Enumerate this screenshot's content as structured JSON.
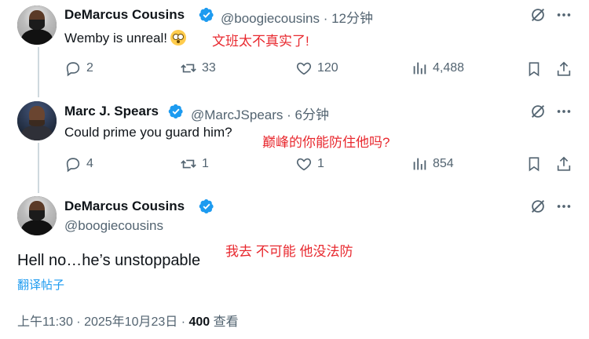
{
  "tweets": [
    {
      "author": "DeMarcus Cousins",
      "handle": "@boogiecousins",
      "time": "12分钟",
      "text": "Wemby is unreal!",
      "annotation": "文班太不真实了!",
      "replies": "2",
      "reposts": "33",
      "likes": "120",
      "views": "4,488"
    },
    {
      "author": "Marc J. Spears",
      "handle": "@MarcJSpears",
      "time": "6分钟",
      "text": "Could prime you guard him?",
      "annotation": "巅峰的你能防住他吗?",
      "replies": "4",
      "reposts": "1",
      "likes": "1",
      "views": "854"
    }
  ],
  "main_tweet": {
    "author": "DeMarcus Cousins",
    "handle": "@boogiecousins",
    "text": "Hell no…he’s unstoppable",
    "annotation": "我去 不可能 他没法防",
    "translate_label": "翻译帖子",
    "timestamp": "上午11:30 · 2025年10月23日 · ",
    "views": "400",
    "views_label": " 查看"
  },
  "colors": {
    "accent": "#1d9bf0",
    "annotation": "#e8292f",
    "muted": "#536471"
  },
  "icons": [
    "verified-badge-icon",
    "grok-icon",
    "more-icon",
    "reply-icon",
    "repost-icon",
    "like-icon",
    "views-icon",
    "bookmark-icon",
    "share-icon"
  ]
}
